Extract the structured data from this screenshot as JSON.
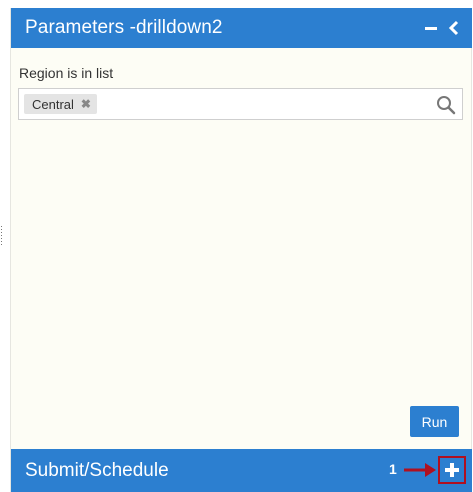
{
  "panel": {
    "title": "Parameters -drilldown2",
    "minimize_icon": "minus-icon",
    "collapse_icon": "chevron-left-icon"
  },
  "parameter": {
    "label": "Region is in list",
    "selected_values": [
      "Central"
    ],
    "remove_icon": "close-icon",
    "search_icon": "search-icon"
  },
  "actions": {
    "run_label": "Run"
  },
  "submit": {
    "title": "Submit/Schedule",
    "annotation_number": "1",
    "add_icon": "plus-icon"
  },
  "colors": {
    "header_blue": "#2c7fd0",
    "panel_background": "#fdfdf5",
    "annotation_red": "#b01020"
  }
}
